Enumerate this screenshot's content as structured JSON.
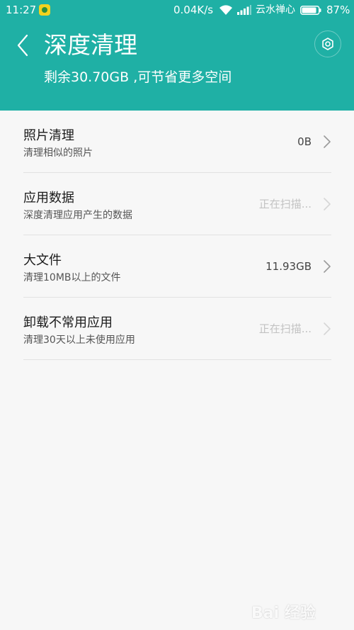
{
  "status_bar": {
    "time": "11:27",
    "net_speed": "0.04K/s",
    "carrier": "云水禅心",
    "battery_percent": "87%",
    "battery_level": 0.87,
    "app_icon": "notification-app-icon",
    "wifi_icon": "wifi-icon",
    "signal_icon": "signal-icon"
  },
  "header": {
    "title": "深度清理",
    "subtitle": "剩余30.70GB ,可节省更多空间",
    "back_icon": "back-icon",
    "settings_icon": "gear-icon",
    "background_color": "#1fb0a5"
  },
  "items": [
    {
      "title": "照片清理",
      "description": "清理相似的照片",
      "value": "0B",
      "state": "done"
    },
    {
      "title": "应用数据",
      "description": "深度清理应用产生的数据",
      "value": "正在扫描...",
      "state": "scanning"
    },
    {
      "title": "大文件",
      "description": "清理10MB以上的文件",
      "value": "11.93GB",
      "state": "done"
    },
    {
      "title": "卸载不常用应用",
      "description": "清理30天以上未使用应用",
      "value": "正在扫描...",
      "state": "scanning"
    }
  ],
  "watermark": {
    "text": "Bai 经验"
  }
}
